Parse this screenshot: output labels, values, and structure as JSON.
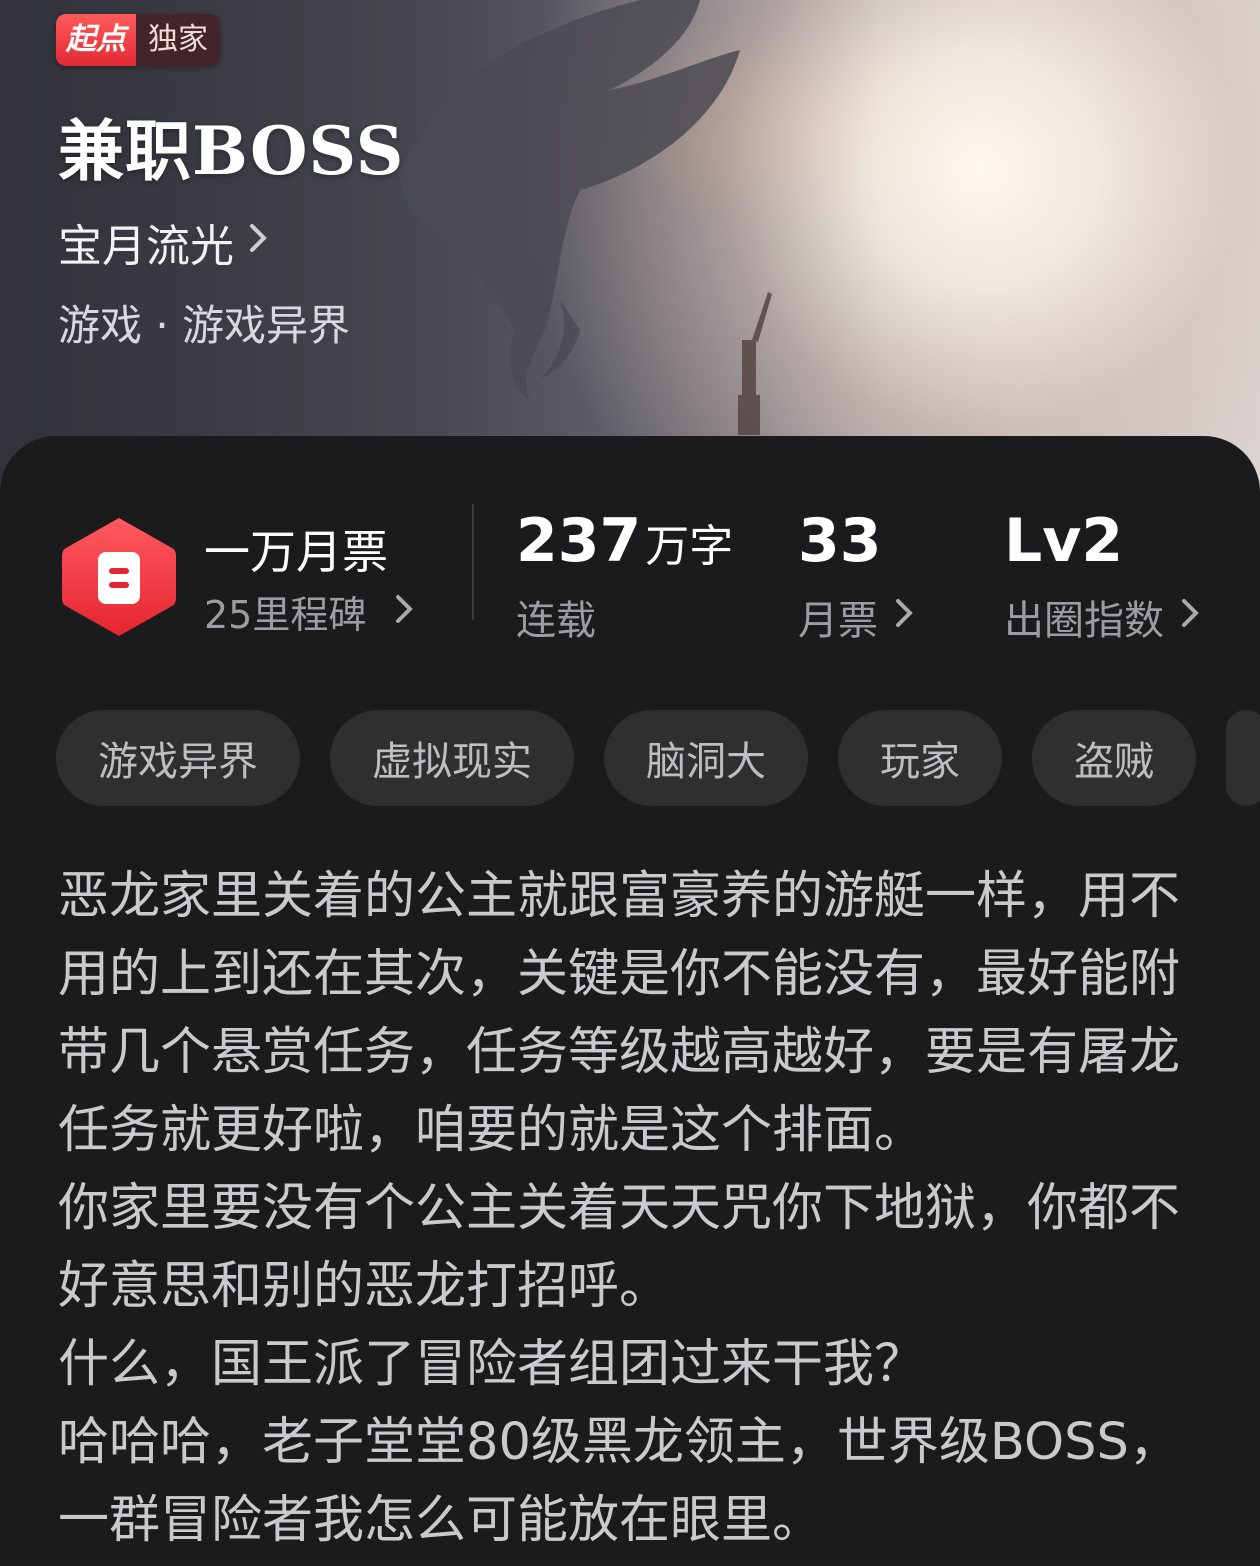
{
  "badge": {
    "brand": "起点",
    "label": "独家"
  },
  "book": {
    "title": "兼职BOSS",
    "author": "宝月流光",
    "genre": "游戏 · 游戏异界"
  },
  "milestone": {
    "name": "一万月票",
    "sub": "25里程碑"
  },
  "stats": {
    "words": {
      "value": "237",
      "unit": "万字",
      "label": "连载"
    },
    "votes": {
      "value": "33",
      "label": "月票"
    },
    "level": {
      "value": "Lv2",
      "label": "出圈指数"
    }
  },
  "tags": [
    "游戏异界",
    "虚拟现实",
    "脑洞大",
    "玩家",
    "盗贼"
  ],
  "description": [
    "恶龙家里关着的公主就跟富豪养的游艇一样，用不用的上到还在其次，关键是你不能没有，最好能附带几个悬赏任务，任务等级越高越好，要是有屠龙任务就更好啦，咱要的就是这个排面。",
    "你家里要没有个公主关着天天咒你下地狱，你都不好意思和别的恶龙打招呼。",
    "什么，国王派了冒险者组团过来干我？",
    "哈哈哈，老子堂堂80级黑龙领主，世界级BOSS，一群冒险者我怎么可能放在眼里。"
  ],
  "colors": {
    "accent": "#ef3b45",
    "background": "#1b1b1d",
    "tag_bg": "#2f2f32"
  }
}
